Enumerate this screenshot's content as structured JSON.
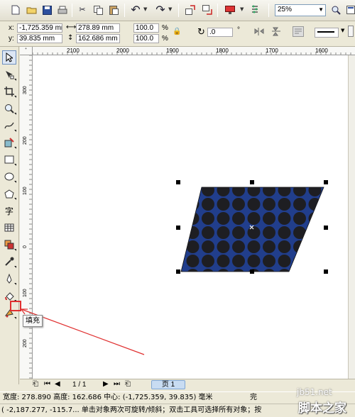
{
  "toolbar": {
    "zoom_value": "25%",
    "icons": [
      "new-doc",
      "open-folder",
      "save",
      "print",
      "cut",
      "copy",
      "paste",
      "undo",
      "redo",
      "import",
      "export",
      "publish-pdf",
      "application-launcher",
      "zoom-level",
      "full-screen",
      "more"
    ]
  },
  "propbar": {
    "x_label": "x:",
    "y_label": "y:",
    "x_value": "-1,725.359 mn",
    "y_value": "39.835 mm",
    "width_value": "278.89 mm",
    "height_value": "162.686 mm",
    "scale_x": "100.0",
    "scale_y": "100.0",
    "percent": "%",
    "rotation_value": ".0",
    "degree": "°"
  },
  "ruler": {
    "h_labels": [
      "2100",
      "2000",
      "1900",
      "1800",
      "1700",
      "1600"
    ],
    "v_labels": [
      "300",
      "200",
      "100",
      "0",
      "100",
      "200"
    ]
  },
  "page_nav": {
    "page_counter": "1 / 1",
    "page_tab": "页 1"
  },
  "tooltip": {
    "text": "填充"
  },
  "status": {
    "line1": "宽度: 278.890  高度: 162.686  中心: (-1,725.359, 39.835)  毫米",
    "line1_right": "完",
    "line2": "( -2,187.277, -115.7...  单击对象两次可旋转/倾斜；双击工具可选择所有对象；按"
  },
  "watermark": {
    "site": "jb51.net",
    "brand": "脚本之家"
  },
  "colors": {
    "shape_fill": "#213e8c",
    "dot_fill": "#1e1e22",
    "arrow": "#e03030",
    "highlight_box": "#e03030"
  }
}
